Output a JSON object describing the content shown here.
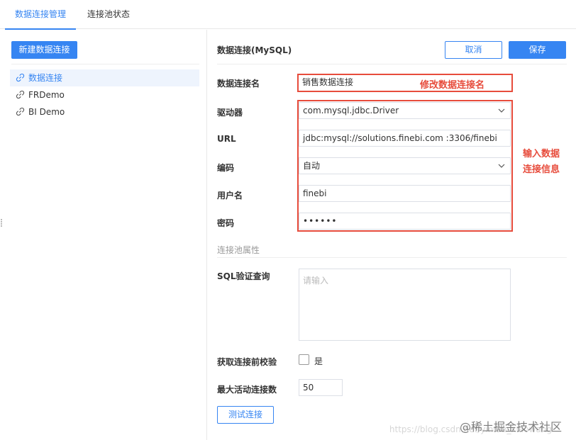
{
  "tabs": [
    {
      "label": "数据连接管理",
      "active": true
    },
    {
      "label": "连接池状态",
      "active": false
    }
  ],
  "sidebar": {
    "new_button": "新建数据连接",
    "connections": [
      {
        "label": "数据连接",
        "selected": true,
        "icon": "link-icon"
      },
      {
        "label": "FRDemo",
        "selected": false,
        "icon": "link-icon"
      },
      {
        "label": "BI Demo",
        "selected": false,
        "icon": "link-icon"
      }
    ]
  },
  "panel": {
    "title": "数据连接(MySQL)",
    "cancel": "取消",
    "save": "保存"
  },
  "form": {
    "name_label": "数据连接名",
    "name_value": "销售数据连接",
    "driver_label": "驱动器",
    "driver_value": "com.mysql.jdbc.Driver",
    "url_label": "URL",
    "url_value": "jdbc:mysql://solutions.finebi.com :3306/finebi",
    "encoding_label": "编码",
    "encoding_value": "自动",
    "user_label": "用户名",
    "user_value": "finebi",
    "password_label": "密码",
    "password_value": "••••••"
  },
  "pool": {
    "section_label": "连接池属性",
    "sql_label": "SQL验证查询",
    "sql_placeholder": "请输入",
    "check_label": "获取连接前校验",
    "check_option": "是",
    "check_value": false,
    "max_label": "最大活动连接数",
    "max_value": "50",
    "test_button": "测试连接"
  },
  "annotations": {
    "name_note": "修改数据连接名",
    "info_note_line1": "输入数据",
    "info_note_line2": "连接信息",
    "color": "#e74c3c"
  },
  "watermark": {
    "main": "@稀土掘金技术社区",
    "faint": "https://blog.csdn.net/yinfan_xiaowang"
  },
  "colors": {
    "accent": "#3685f2",
    "annotation": "#e74c3c"
  }
}
